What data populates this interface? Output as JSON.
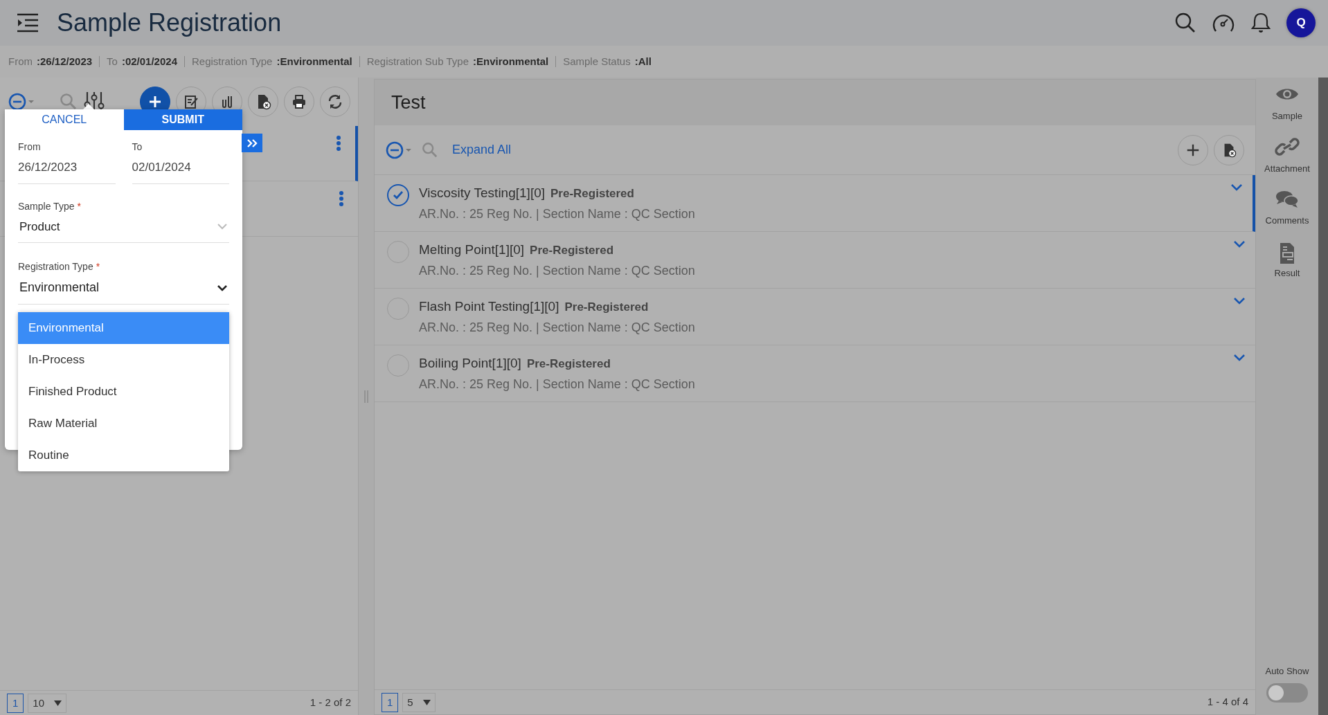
{
  "header": {
    "title": "Sample Registration",
    "avatar": "Q"
  },
  "filter_summary": [
    {
      "label": "From",
      "value": ":26/12/2023"
    },
    {
      "label": "To",
      "value": ":02/01/2024"
    },
    {
      "label": "Registration Type",
      "value": ":Environmental"
    },
    {
      "label": "Registration Sub Type",
      "value": ":Environmental"
    },
    {
      "label": "Sample Status",
      "value": ":All"
    }
  ],
  "sample_panel": {
    "items": [
      {
        "selected": true
      },
      {
        "selected": false
      }
    ],
    "pagination": {
      "page": "1",
      "page_size": "10",
      "range": "1 - 2 of 2"
    }
  },
  "filter_popup": {
    "cancel": "CANCEL",
    "submit": "SUBMIT",
    "from": {
      "label": "From",
      "value": "26/12/2023"
    },
    "to": {
      "label": "To",
      "value": "02/01/2024"
    },
    "sample_type": {
      "label": "Sample Type",
      "required_mark": "*",
      "value": "Product"
    },
    "registration_type": {
      "label": "Registration Type",
      "required_mark": "*",
      "value": "Environmental",
      "expanded": true
    },
    "options": [
      {
        "label": "Environmental",
        "selected": true
      },
      {
        "label": "In-Process",
        "selected": false
      },
      {
        "label": "Finished Product",
        "selected": false
      },
      {
        "label": "Raw Material",
        "selected": false
      },
      {
        "label": "Routine",
        "selected": false
      }
    ]
  },
  "test_panel": {
    "title": "Test",
    "expand_all": "Expand All",
    "tests": [
      {
        "name": "Viscosity Testing[1][0]",
        "status": "Pre-Registered",
        "details": "AR.No. : 25 Reg No. | Section Name : QC Section",
        "checked": true,
        "selected": true
      },
      {
        "name": "Melting Point[1][0]",
        "status": "Pre-Registered",
        "details": "AR.No. : 25 Reg No. | Section Name : QC Section",
        "checked": false,
        "selected": false
      },
      {
        "name": "Flash Point Testing[1][0]",
        "status": "Pre-Registered",
        "details": "AR.No. : 25 Reg No. | Section Name : QC Section",
        "checked": false,
        "selected": false
      },
      {
        "name": "Boiling Point[1][0]",
        "status": "Pre-Registered",
        "details": "AR.No. : 25 Reg No. | Section Name : QC Section",
        "checked": false,
        "selected": false
      }
    ],
    "pagination": {
      "page": "1",
      "page_size": "5",
      "range": "1 - 4 of 4"
    }
  },
  "right_sidebar": {
    "items": [
      {
        "label": "Sample"
      },
      {
        "label": "Attachment"
      },
      {
        "label": "Comments"
      },
      {
        "label": "Result"
      }
    ],
    "auto_show": {
      "label": "Auto Show",
      "on": false
    }
  }
}
